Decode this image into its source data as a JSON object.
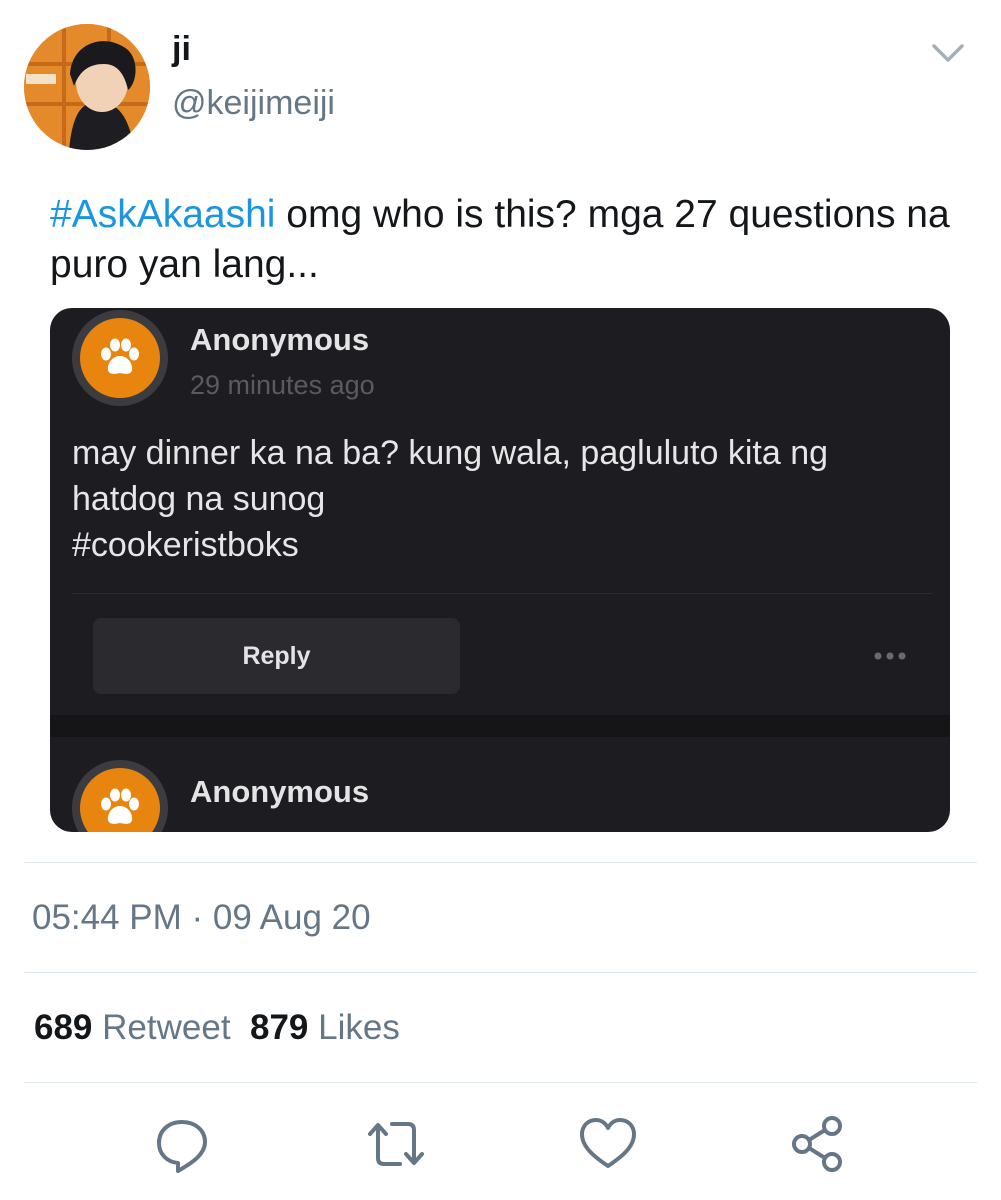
{
  "user": {
    "display_name": "ji",
    "handle": "@keijimeiji"
  },
  "tweet": {
    "hashtag": "#AskAkaashi",
    "text": " omg who is this? mga 27 questions na puro yan lang..."
  },
  "media": {
    "question1": {
      "sender": "Anonymous",
      "time": "29 minutes ago",
      "line1": "may dinner ka na ba? kung wala, pagluluto kita ng",
      "line2": "hatdog na sunog",
      "line3": "#cookeristboks",
      "reply_label": "Reply"
    },
    "question2": {
      "sender": "Anonymous"
    }
  },
  "meta": {
    "timestamp": "05:44 PM · 09 Aug 20"
  },
  "stats": {
    "retweets_count": "689",
    "retweets_label": "Retweet",
    "likes_count": "879",
    "likes_label": "Likes"
  },
  "colors": {
    "link": "#1b95e0",
    "secondary_text": "#657786",
    "media_bg": "#1d1d21",
    "paw_orange": "#e8850f"
  },
  "icons": [
    "chevron-down-icon",
    "paw-icon",
    "more-dots-icon",
    "reply-icon",
    "retweet-icon",
    "like-icon",
    "share-icon"
  ]
}
